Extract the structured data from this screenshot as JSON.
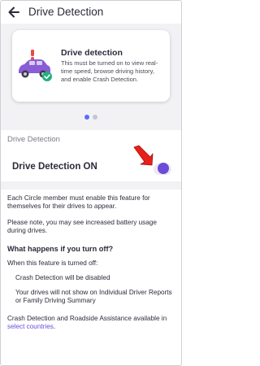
{
  "header": {
    "title": "Drive Detection",
    "back_icon": "arrow-left-icon"
  },
  "card": {
    "title": "Drive detection",
    "description": "This must be turned on to view real-time speed, browse driving history, and enable Crash Detection.",
    "illustration_icon": "car-alert-icon"
  },
  "pager": {
    "current": 1,
    "total": 2
  },
  "section_label": "Drive Detection",
  "setting": {
    "label": "Drive Detection ON",
    "toggle_on": true,
    "accent": "#6c4cd6"
  },
  "annotation": {
    "icon": "red-arrow-icon",
    "color": "#e8201a"
  },
  "info": {
    "paragraph1": "Each Circle member must enable this feature for themselves for their drives to appear.",
    "paragraph2": "Please note, you may see increased battery usage during drives.",
    "heading": "What happens if you turn off?",
    "intro": "When this feature is turned off:",
    "bullet1": "Crash Detection will be disabled",
    "bullet2": "Your drives will not show on Individual Driver Reports or Family Driving Summary",
    "footer_text": "Crash Detection and Roadside Assistance available in",
    "footer_link": "select countries",
    "footer_end": "."
  }
}
